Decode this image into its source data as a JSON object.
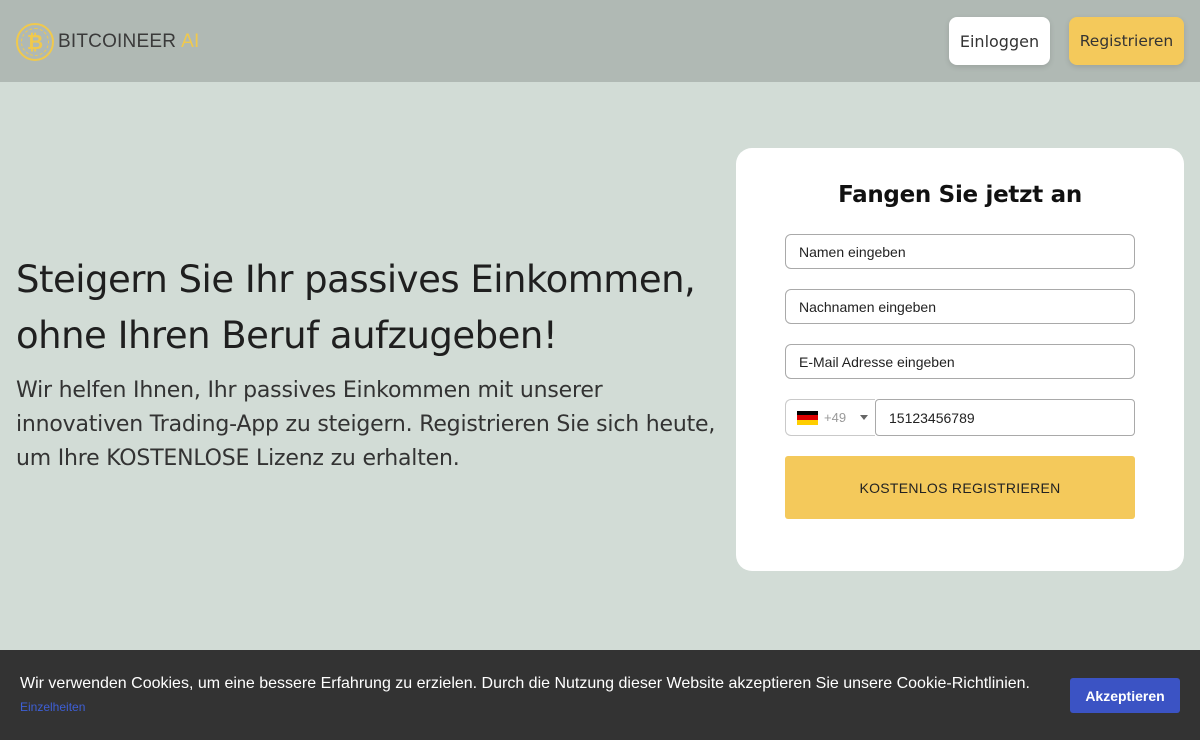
{
  "header": {
    "logo_symbol": "₿",
    "logo_name": "BITCOINEER",
    "logo_suffix": "AI",
    "login_label": "Einloggen",
    "register_label": "Registrieren"
  },
  "hero": {
    "title_line1": "Steigern Sie Ihr passives Einkommen,",
    "title_line2": "ohne Ihren Beruf aufzugeben!",
    "text": "Wir helfen Ihnen, Ihr passives Einkommen mit unserer innovativen Trading-App zu steigern. Registrieren Sie sich heute, um Ihre KOSTENLOSE Lizenz zu erhalten."
  },
  "form": {
    "title": "Fangen Sie jetzt an",
    "first_name_placeholder": "Namen eingeben",
    "last_name_placeholder": "Nachnamen eingeben",
    "email_placeholder": "E-Mail Adresse eingeben",
    "dial_code": "+49",
    "country_flag": "germany-flag",
    "phone_value": "15123456789",
    "submit_label": "KOSTENLOS REGISTRIEREN"
  },
  "cookie": {
    "text": "Wir verwenden Cookies, um eine bessere Erfahrung zu erzielen. Durch die Nutzung dieser Website akzeptieren Sie unsere Cookie-Richtlinien.",
    "details_label": "Einzelheiten",
    "accept_label": "Akzeptieren"
  },
  "colors": {
    "header_bg": "#b0b9b4",
    "page_bg": "#d2dcd6",
    "accent_yellow": "#f4c95b",
    "cookie_bg": "#333333",
    "cookie_button": "#3b53c4"
  }
}
